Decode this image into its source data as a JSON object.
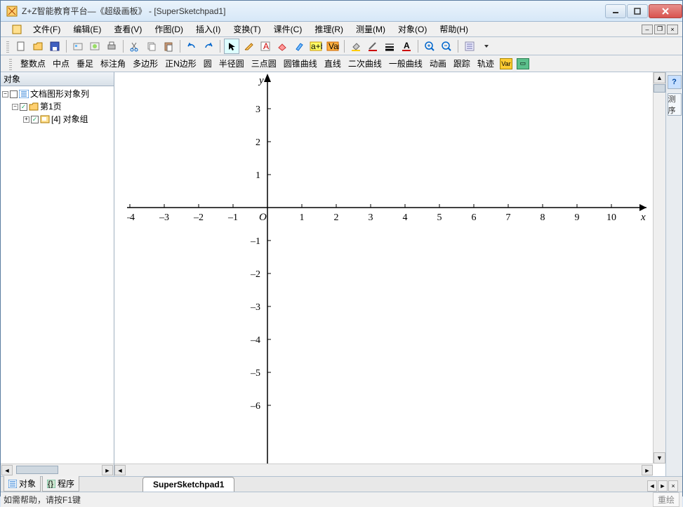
{
  "window": {
    "title": "Z+Z智能教育平台—《超级画板》 - [SuperSketchpad1]"
  },
  "menubar": {
    "file": "文件(F)",
    "edit": "编辑(E)",
    "view": "查看(V)",
    "draw": "作图(D)",
    "insert": "插入(I)",
    "transform": "变换(T)",
    "courseware": "课件(C)",
    "reason": "推理(R)",
    "measure": "测量(M)",
    "object": "对象(O)",
    "help": "帮助(H)"
  },
  "toolbar2": {
    "integer_point": "整数点",
    "midpoint": "中点",
    "perpendicular": "垂足",
    "mark_angle": "标注角",
    "polygon": "多边形",
    "regular_ngon": "正N边形",
    "circle": "圆",
    "semicircle": "半径圆",
    "three_point_circle": "三点圆",
    "conic": "圆锥曲线",
    "line": "直线",
    "quadratic": "二次曲线",
    "general_curve": "一般曲线",
    "animate": "动画",
    "trace": "跟踪",
    "locus": "轨迹"
  },
  "sidebar": {
    "title": "对象",
    "root": "文档图形对象列",
    "page1": "第1页",
    "group": "[4] 对象组"
  },
  "tabs": {
    "side_obj": "对象",
    "side_prog": "程序",
    "doc": "SuperSketchpad1"
  },
  "statusbar": {
    "help": "如需帮助，请按F1键",
    "redraw": "重绘"
  },
  "right": {
    "help": "?",
    "measure": "测序"
  },
  "chart_data": {
    "type": "scatter",
    "title": "",
    "xlabel": "x",
    "ylabel": "y",
    "xlim": [
      -4,
      10.5
    ],
    "ylim": [
      -6.5,
      3.5
    ],
    "x_ticks": [
      -4,
      -3,
      -2,
      -1,
      1,
      2,
      3,
      4,
      5,
      6,
      7,
      8,
      9,
      10
    ],
    "y_ticks": [
      -6,
      -5,
      -4,
      -3,
      -2,
      -1,
      1,
      2,
      3
    ],
    "origin_label": "O",
    "series": []
  }
}
